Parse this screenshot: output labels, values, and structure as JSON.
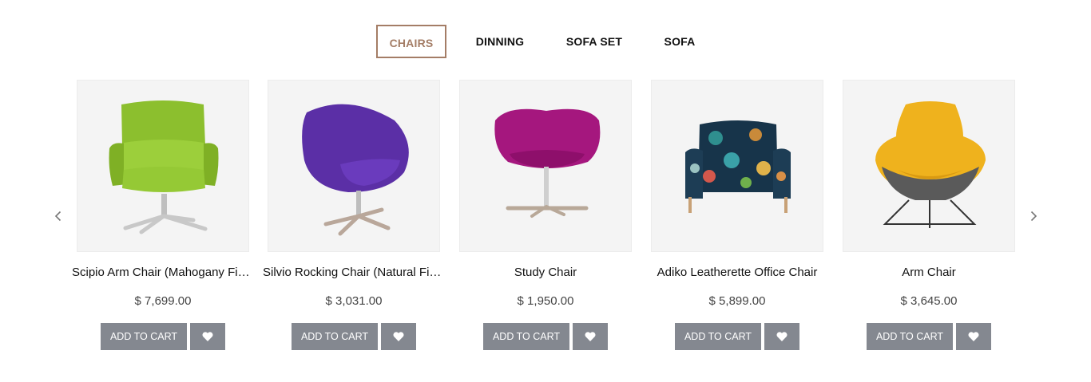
{
  "tabs": [
    {
      "label": "CHAIRS",
      "active": true
    },
    {
      "label": "DINNING",
      "active": false
    },
    {
      "label": "SOFA SET",
      "active": false
    },
    {
      "label": "SOFA",
      "active": false
    }
  ],
  "colors": {
    "accent": "#a47d66",
    "button_bg": "#848890",
    "thumb_bg": "#f4f4f4"
  },
  "nav": {
    "prev_icon": "chevron-left-icon",
    "next_icon": "chevron-right-icon"
  },
  "products": [
    {
      "name": "Scipio Arm Chair (Mahogany Finish)",
      "price": "$ 7,699.00",
      "add_to_cart": "ADD TO CART",
      "wishlist_icon": "heart-icon",
      "image": "green-arm-chair"
    },
    {
      "name": "Silvio Rocking Chair (Natural Finish)",
      "price": "$ 3,031.00",
      "add_to_cart": "ADD TO CART",
      "wishlist_icon": "heart-icon",
      "image": "purple-egg-chair"
    },
    {
      "name": "Study Chair",
      "price": "$ 1,950.00",
      "add_to_cart": "ADD TO CART",
      "wishlist_icon": "heart-icon",
      "image": "magenta-swivel-chair"
    },
    {
      "name": "Adiko Leatherette Office Chair",
      "price": "$ 5,899.00",
      "add_to_cart": "ADD TO CART",
      "wishlist_icon": "heart-icon",
      "image": "floral-armchair"
    },
    {
      "name": "Arm Chair",
      "price": "$ 3,645.00",
      "add_to_cart": "ADD TO CART",
      "wishlist_icon": "heart-icon",
      "image": "yellow-lounge-chair"
    }
  ]
}
